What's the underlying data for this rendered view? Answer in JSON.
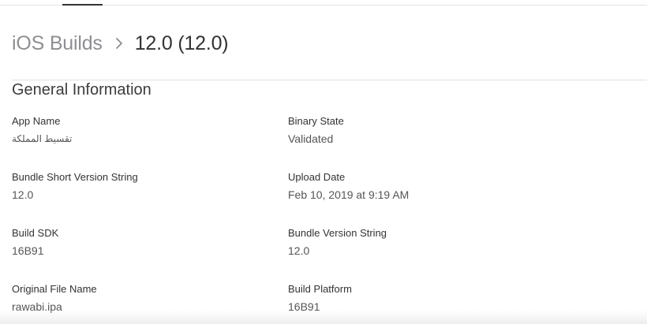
{
  "breadcrumb": {
    "parent": "iOS Builds",
    "current": "12.0 (12.0)"
  },
  "section": {
    "title": "General Information"
  },
  "fields": {
    "app_name": {
      "label": "App Name",
      "value": "تقسيط المملكة"
    },
    "binary_state": {
      "label": "Binary State",
      "value": "Validated"
    },
    "bundle_short_version": {
      "label": "Bundle Short Version String",
      "value": "12.0"
    },
    "upload_date": {
      "label": "Upload Date",
      "value": "Feb 10, 2019 at 9:19 AM"
    },
    "build_sdk": {
      "label": "Build SDK",
      "value": "16B91"
    },
    "bundle_version": {
      "label": "Bundle Version String",
      "value": "12.0"
    },
    "original_file_name": {
      "label": "Original File Name",
      "value": "rawabi.ipa"
    },
    "build_platform": {
      "label": "Build Platform",
      "value": "16B91"
    }
  },
  "icons": {
    "breadcrumb_separator": "chevron-right-icon"
  }
}
